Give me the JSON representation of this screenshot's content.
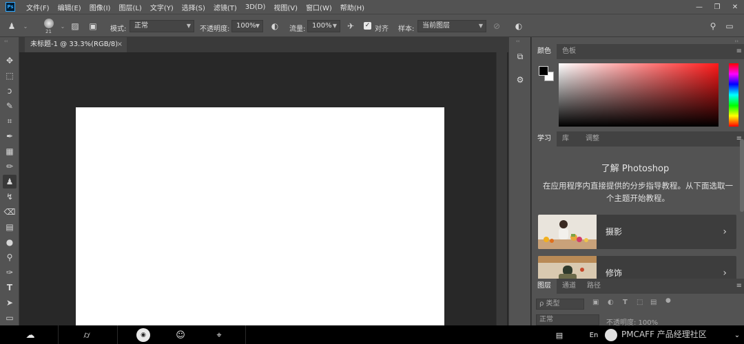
{
  "app": {
    "logo_text": "Ps"
  },
  "menu": [
    "文件(F)",
    "编辑(E)",
    "图像(I)",
    "图层(L)",
    "文字(Y)",
    "选择(S)",
    "滤镜(T)",
    "3D(D)",
    "视图(V)",
    "窗口(W)",
    "帮助(H)"
  ],
  "window_controls": {
    "minimize": "—",
    "restore": "❐",
    "close": "✕"
  },
  "options": {
    "brush_size": "21",
    "mode_label": "模式:",
    "mode_value": "正常",
    "opacity_label": "不透明度:",
    "opacity_value": "100%",
    "flow_label": "流量:",
    "flow_value": "100%",
    "aligned_label": "对齐",
    "aligned_checked": true,
    "sample_label": "样本:",
    "sample_value": "当前图层"
  },
  "document": {
    "tab_title": "未标题-1 @ 33.3%(RGB/8)",
    "close": "×"
  },
  "tools": [
    {
      "name": "move-tool",
      "glyph": "✥"
    },
    {
      "name": "marquee-tool",
      "glyph": "⬚"
    },
    {
      "name": "lasso-tool",
      "glyph": "ↄ"
    },
    {
      "name": "quick-select-tool",
      "glyph": "✎"
    },
    {
      "name": "crop-tool",
      "glyph": "⌗"
    },
    {
      "name": "eyedropper-tool",
      "glyph": "✒"
    },
    {
      "name": "healing-tool",
      "glyph": "▦"
    },
    {
      "name": "brush-tool",
      "glyph": "✏"
    },
    {
      "name": "clone-stamp-tool",
      "glyph": "♟"
    },
    {
      "name": "history-brush-tool",
      "glyph": "↯"
    },
    {
      "name": "eraser-tool",
      "glyph": "⌫"
    },
    {
      "name": "gradient-tool",
      "glyph": "▤"
    },
    {
      "name": "blur-tool",
      "glyph": "●"
    },
    {
      "name": "dodge-tool",
      "glyph": "⚲"
    },
    {
      "name": "pen-tool",
      "glyph": "✑"
    },
    {
      "name": "type-tool",
      "glyph": "T"
    },
    {
      "name": "path-select-tool",
      "glyph": "➤"
    },
    {
      "name": "rectangle-tool",
      "glyph": "▭"
    }
  ],
  "color_panel": {
    "tabs": [
      "颜色",
      "色板"
    ]
  },
  "learn_panel": {
    "tabs": [
      "学习",
      "库",
      "调整"
    ],
    "title": "了解 Photoshop",
    "description": "在应用程序内直接提供的分步指导教程。从下面选取一个主题开始教程。",
    "topics": [
      "摄影",
      "修饰"
    ]
  },
  "layers_panel": {
    "tabs": [
      "图层",
      "通道",
      "路径"
    ],
    "kind_placeholder": "ρ 类型",
    "blend_mode": "正常",
    "opacity_label": "不透明度: 100%"
  },
  "taskbar": {
    "watermark": "PMCAFF 产品经理社区"
  }
}
